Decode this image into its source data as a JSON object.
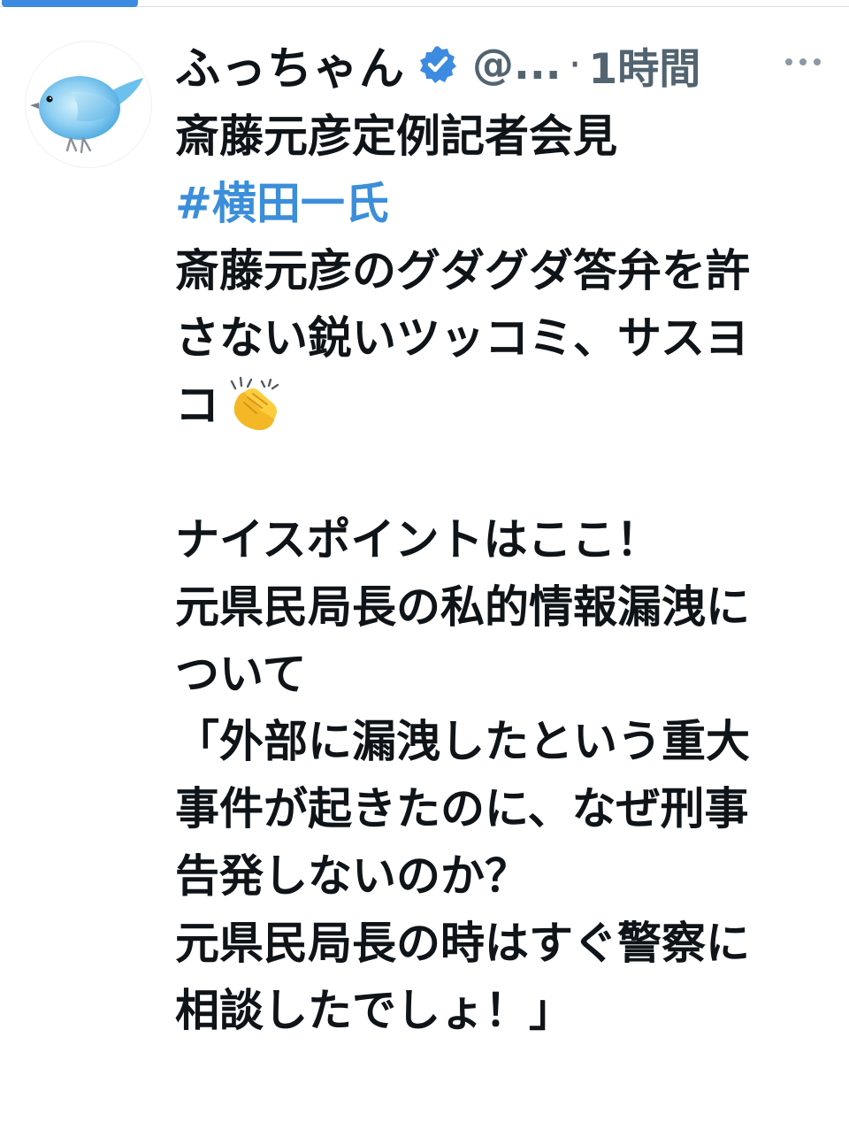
{
  "tweet": {
    "display_name": "ふっちゃん",
    "handle": "@...",
    "separator": "·",
    "time": "1時間",
    "lines": [
      {
        "text": "斎藤元彦定例記者会見",
        "kind": "text"
      },
      {
        "text": "#横田一氏",
        "kind": "hashtag"
      },
      {
        "text": "斎藤元彦のグダグダ答弁を許",
        "kind": "text"
      },
      {
        "text": "さない鋭いツッコミ、サスヨ",
        "kind": "text"
      },
      {
        "text": "コ",
        "kind": "text"
      },
      {
        "text": "",
        "kind": "blank"
      },
      {
        "text": "ナイスポイントはここ！",
        "kind": "text"
      },
      {
        "text": "元県民局長の私的情報漏洩に",
        "kind": "text"
      },
      {
        "text": "ついて",
        "kind": "text"
      },
      {
        "text": "「外部に漏洩したという重大",
        "kind": "text"
      },
      {
        "text": "事件が起きたのに、なぜ刑事",
        "kind": "text"
      },
      {
        "text": "告発しないのか？",
        "kind": "text"
      },
      {
        "text": "元県民局長の時はすぐ警察に",
        "kind": "text"
      },
      {
        "text": "相談したでしょ！」",
        "kind": "text"
      }
    ],
    "icons": {
      "avatar": "blue-bird-avatar",
      "verified": "verified-badge-icon",
      "more": "more-options-icon",
      "emoji": "clapping-hands-emoji"
    },
    "colors": {
      "hashtag": "#3b8ed9",
      "verified": "#3d8be0",
      "muted": "#536471"
    }
  }
}
